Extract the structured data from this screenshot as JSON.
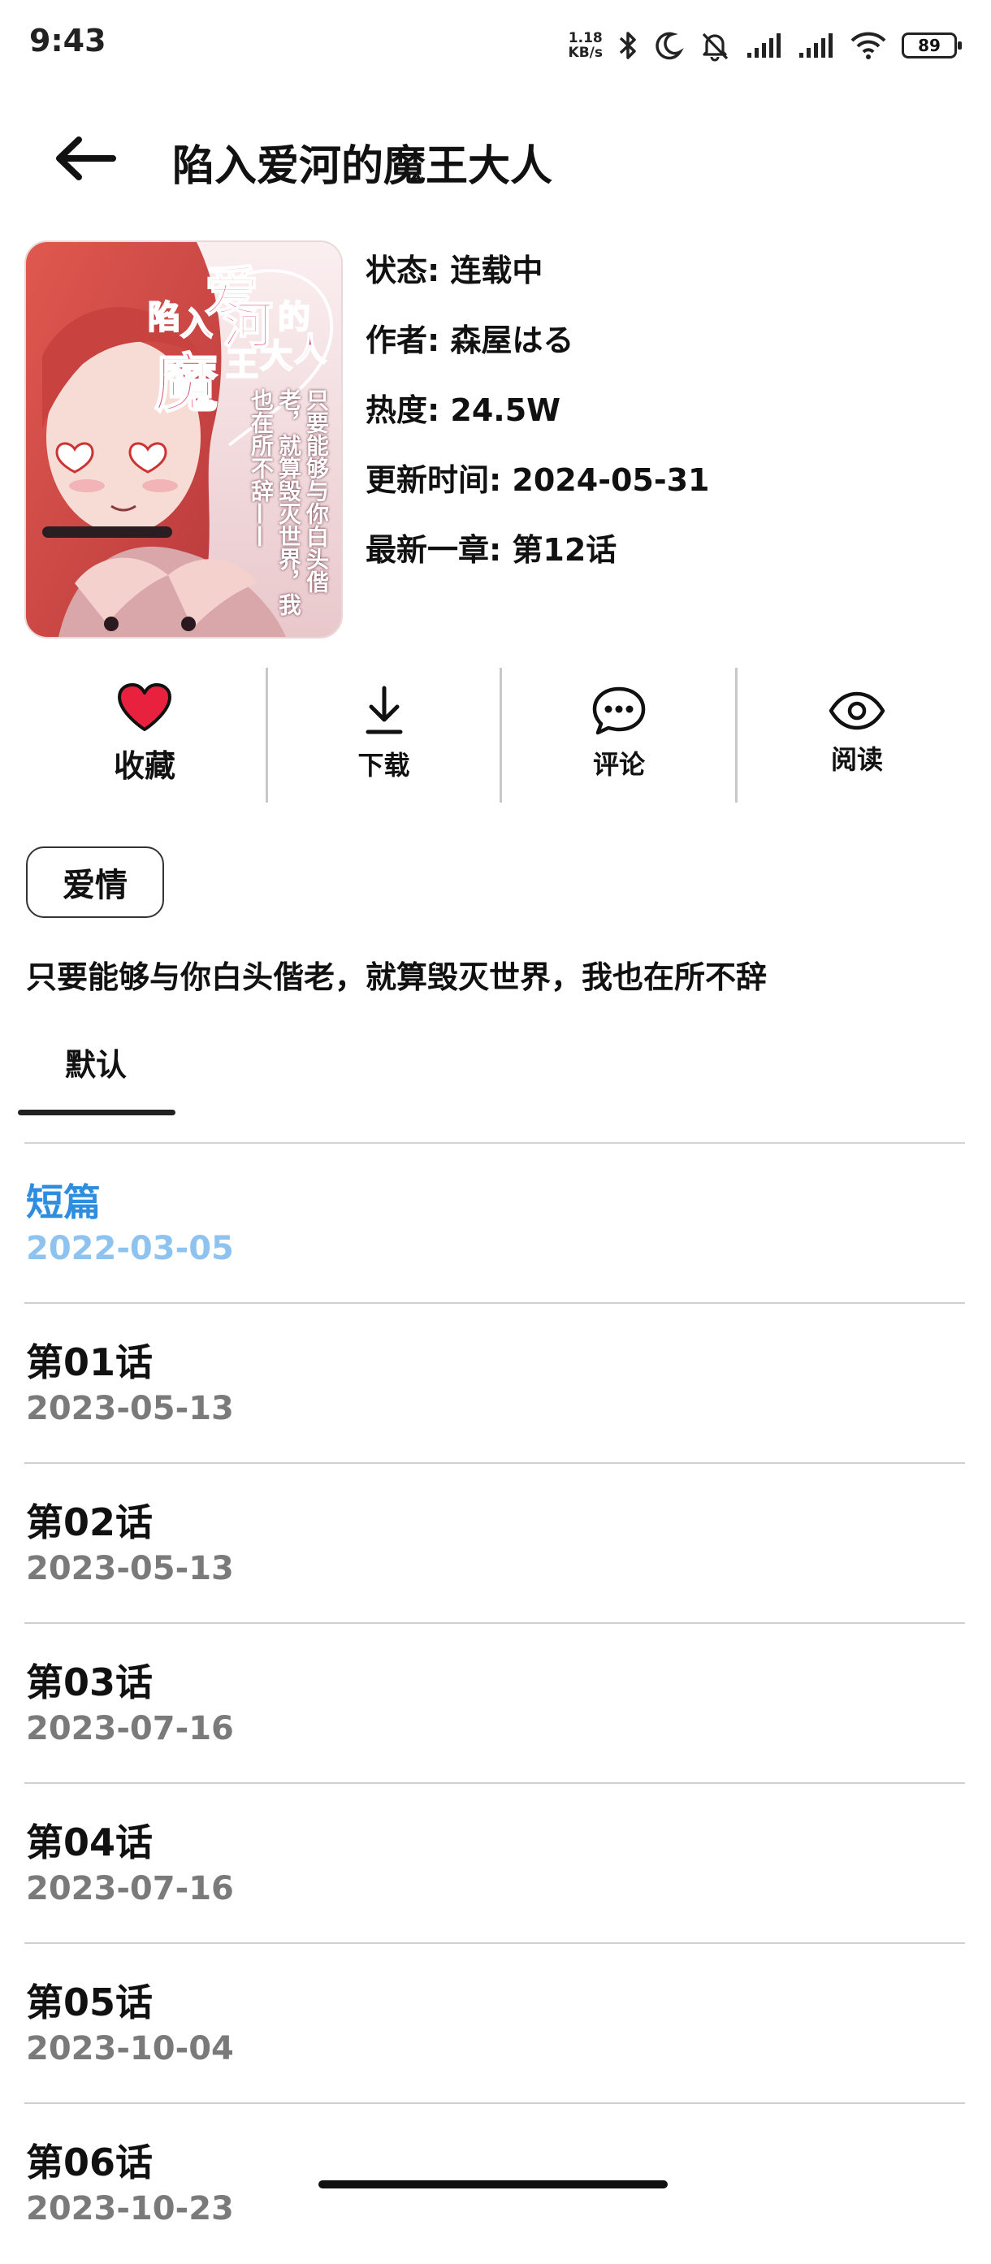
{
  "status_bar": {
    "time": "9:43",
    "net_speed_value": "1.18",
    "net_speed_unit": "KB/s",
    "battery": "89",
    "icons": [
      "bluetooth-icon",
      "moon-icon",
      "bell-off-icon",
      "signal-icon",
      "signal-icon",
      "wifi-icon",
      "battery-icon"
    ]
  },
  "header": {
    "back_icon": "arrow-left-icon",
    "title": "陷入爱河的魔王大人"
  },
  "cover": {
    "title_chars": [
      "陷",
      "入",
      "爱",
      "河",
      "的",
      "魔",
      "王",
      "大",
      "人"
    ],
    "tagline": "只要能够与你白头偕老，就算毁灭世界，我也在所不辞——"
  },
  "info": {
    "status": "状态: 连载中",
    "author": "作者: 森屋はる",
    "popularity": "热度: 24.5W",
    "updated": "更新时间: 2024-05-31",
    "latest": "最新一章: 第12话"
  },
  "actions": [
    {
      "label": "收藏",
      "icon": "heart-icon",
      "color": "#e8213f"
    },
    {
      "label": "下载",
      "icon": "download-icon"
    },
    {
      "label": "评论",
      "icon": "comment-icon"
    },
    {
      "label": "阅读",
      "icon": "eye-icon"
    }
  ],
  "tag": "爱情",
  "description": "只要能够与你白头偕老，就算毁灭世界，我也在所不辞",
  "tabs": [
    "默认"
  ],
  "chapters": [
    {
      "title": "短篇",
      "date": "2022-03-05",
      "active": true
    },
    {
      "title": "第01话",
      "date": "2023-05-13"
    },
    {
      "title": "第02话",
      "date": "2023-05-13"
    },
    {
      "title": "第03话",
      "date": "2023-07-16"
    },
    {
      "title": "第04话",
      "date": "2023-07-16"
    },
    {
      "title": "第05话",
      "date": "2023-10-04"
    },
    {
      "title": "第06话",
      "date": "2023-10-23"
    }
  ],
  "colors": {
    "accent": "#2f8ddf",
    "accent_light": "#8ec3ef",
    "favorite": "#e8213f"
  }
}
